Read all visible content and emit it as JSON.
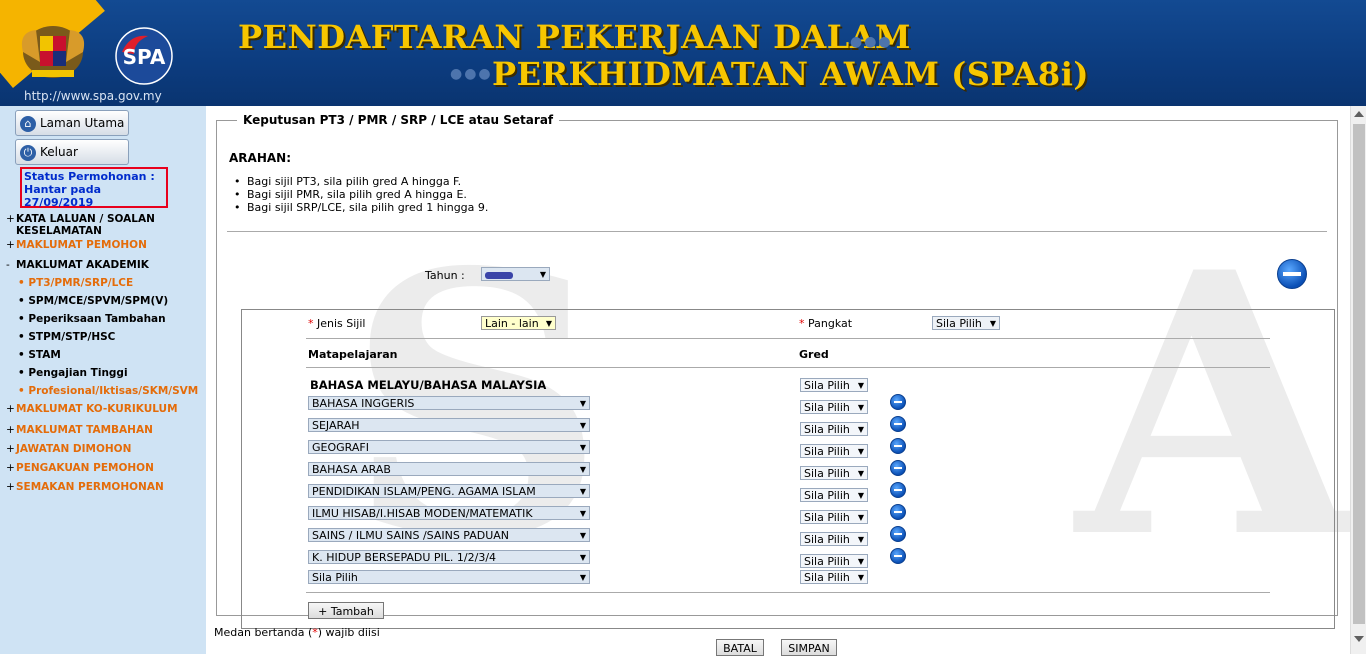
{
  "header": {
    "title_line1": "PENDAFTARAN PEKERJAAN DALAM",
    "title_line2": "PERKHIDMATAN AWAM (SPA8i)",
    "url": "http://www.spa.gov.my"
  },
  "sidebar": {
    "home_label": "Laman Utama",
    "logout_label": "Keluar",
    "status_line1": "Status Permohonan :",
    "status_line2": "Hantar pada",
    "status_line3": "27/09/2019",
    "items": [
      {
        "pm": "+",
        "label": "KATA LALUAN / SOALAN",
        "label2": "KESELAMATAN"
      },
      {
        "pm": "+",
        "label": "MAKLUMAT PEMOHON"
      },
      {
        "pm": "-",
        "label": "MAKLUMAT AKADEMIK"
      },
      {
        "pm": "+",
        "label": "MAKLUMAT KO-KURIKULUM"
      },
      {
        "pm": "+",
        "label": "MAKLUMAT TAMBAHAN"
      },
      {
        "pm": "+",
        "label": "JAWATAN DIMOHON"
      },
      {
        "pm": "+",
        "label": "PENGAKUAN PEMOHON"
      },
      {
        "pm": "+",
        "label": "SEMAKAN PERMOHONAN"
      }
    ],
    "sub_items": [
      "PT3/PMR/SRP/LCE",
      "SPM/MCE/SPVM/SPM(V)",
      "Peperiksaan Tambahan",
      "STPM/STP/HSC",
      "STAM",
      "Pengajian Tinggi",
      "Profesional/Iktisas/SKM/SVM"
    ]
  },
  "form": {
    "legend": "Keputusan PT3 / PMR / SRP / LCE atau Setaraf",
    "arahan": "ARAHAN:",
    "instructions": [
      "Bagi sijil PT3, sila pilih gred A hingga F.",
      "Bagi sijil PMR, sila pilih gred A hingga E.",
      "Bagi sijil SRP/LCE, sila pilih gred 1 hingga 9."
    ],
    "tahun_label": "Tahun :",
    "jenis_sijil_label": "Jenis Sijil",
    "jenis_sijil_value": "Lain - lain",
    "pangkat_label": "Pangkat",
    "pangkat_value": "Sila Pilih",
    "col_subject": "Matapelajaran",
    "col_grade": "Gred",
    "fixed_subject": "BAHASA MELAYU/BAHASA MALAYSIA",
    "subjects": [
      "BAHASA INGGERIS",
      "SEJARAH",
      "GEOGRAFI",
      "BAHASA ARAB",
      "PENDIDIKAN ISLAM/PENG. AGAMA ISLAM",
      "ILMU HISAB/I.HISAB MODEN/MATEMATIK",
      "SAINS / ILMU SAINS /SAINS PADUAN",
      "K. HIDUP BERSEPADU PIL. 1/2/3/4",
      "Sila Pilih"
    ],
    "grade_placeholder": "Sila Pilih",
    "add_button": "+ Tambah",
    "required_note_pre": "Medan bertanda (",
    "required_star": "*",
    "required_note_post": ") wajib diisi",
    "cancel_button": "BATAL",
    "save_button": "SIMPAN"
  },
  "colors": {
    "header_bg": "#0d3f82",
    "title_gold": "#f7c600",
    "sidebar_bg": "#cfe3f4",
    "link_orange": "#e46c0a",
    "status_border": "#e8001c"
  }
}
